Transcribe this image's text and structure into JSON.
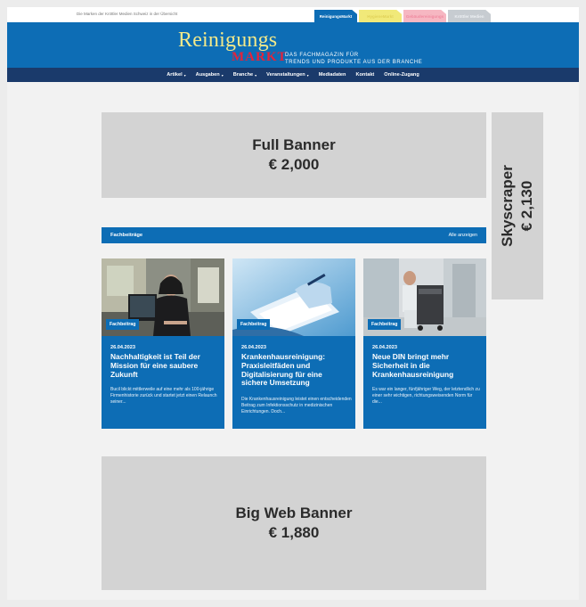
{
  "topbar": {
    "text": "Die Marken der Kröttler Medien Schweiz in der Übersicht",
    "tabs": [
      "ReinigungsMarkt",
      "HygieneMarkt",
      "Gebäudereinigungs",
      "Kröttler Medien"
    ]
  },
  "header": {
    "logo_top": "Reinigungs",
    "logo_bottom": "MARKT",
    "tagline_line1": "DAS FACHMAGAZIN FÜR",
    "tagline_line2": "TRENDS UND PRODUKTE AUS DER BRANCHE"
  },
  "nav": {
    "items": [
      {
        "label": "Artikel",
        "caret": "▾"
      },
      {
        "label": "Ausgaben",
        "caret": "▾"
      },
      {
        "label": "Branche",
        "caret": "▾"
      },
      {
        "label": "Veranstaltungen",
        "caret": "▾"
      },
      {
        "label": "Mediadaten",
        "caret": ""
      },
      {
        "label": "Kontakt",
        "caret": ""
      },
      {
        "label": "Online-Zugang",
        "caret": ""
      }
    ]
  },
  "ads": {
    "full": {
      "name": "Full Banner",
      "price": "€ 2,000"
    },
    "sky": {
      "name": "Skyscraper",
      "price": "€ 2,130"
    },
    "big": {
      "name": "Big Web Banner",
      "price": "€ 1,880"
    }
  },
  "section": {
    "title": "Fachbeiträge",
    "link": "Alle anzeigen"
  },
  "cards": [
    {
      "badge": "Fachbeitrag",
      "date": "26.04.2023",
      "title": "Nachhaltigkeit ist Teil der Mission für eine saubere Zukunft",
      "text": "Bucil blickt mittlerweile auf eine mehr als 100-jährige Firmenhistorie zurück und startet jetzt einen Relaunch seiner..."
    },
    {
      "badge": "Fachbeitrag",
      "date": "26.04.2023",
      "title": "Krankenhausreinigung: Praxisleitfäden und Digitalisierung für eine sichere Umsetzung",
      "text": "Die Krankenhausreinigung leistet einen entscheidenden Beitrag zum Infektionsschutz in medizinischen Einrichtungen. Doch..."
    },
    {
      "badge": "Fachbeitrag",
      "date": "26.04.2023",
      "title": "Neue DIN bringt mehr Sicherheit in die Krankenhausreinigung",
      "text": "Es war ein langer, fünfjähriger Weg, der letztendlich zu einer sehr wichtigen, richtungsweisenden Norm für die..."
    }
  ],
  "colors": {
    "brand_blue": "#0d6db5",
    "nav_blue": "#1a3a6b",
    "logo_yellow": "#f3e98a",
    "logo_red": "#e4233b",
    "ad_gray": "#d3d3d3"
  }
}
